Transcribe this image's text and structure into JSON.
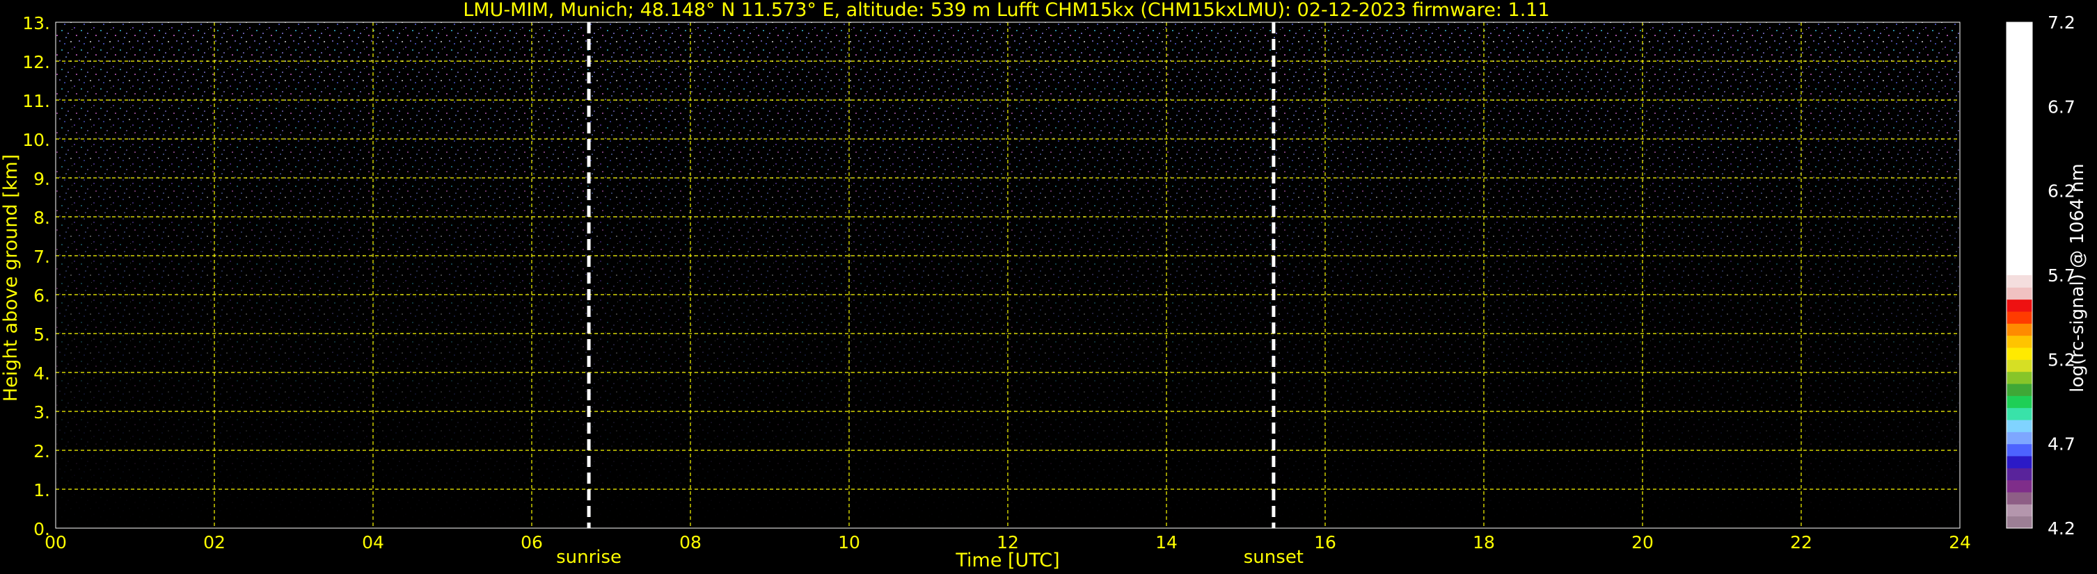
{
  "chart_data": {
    "type": "heatmap",
    "title": "LMU-MIM, Munich; 48.148° N 11.573° E, altitude: 539 m    Lufft CHM15kx (CHM15kxLMU): 02-12-2023    firmware: 1.11",
    "xlabel": "Time [UTC]",
    "ylabel": "Height above ground [km]",
    "x_ticks": [
      "00",
      "02",
      "04",
      "06",
      "08",
      "10",
      "12",
      "14",
      "16",
      "18",
      "20",
      "22",
      "24"
    ],
    "y_ticks": [
      "0.",
      "1.",
      "2.",
      "3.",
      "4.",
      "5.",
      "6.",
      "7.",
      "8.",
      "9.",
      "10.",
      "11.",
      "12.",
      "13."
    ],
    "xlim": [
      0,
      24
    ],
    "ylim": [
      0,
      13
    ],
    "grid": true,
    "annotations": [
      {
        "label": "sunrise",
        "time": 6.72
      },
      {
        "label": "sunset",
        "time": 15.35
      }
    ],
    "colorbar": {
      "label": "log(rc-signal) @ 1064 nm",
      "range": [
        4.2,
        7.2
      ],
      "ticks": [
        "4.2",
        "4.7",
        "5.2",
        "5.7",
        "6.2",
        "6.7",
        "7.2"
      ]
    },
    "colors": {
      "background": "#000000",
      "text": "#ffff00",
      "grid": "#ffff00",
      "marker": "#ffffff",
      "noise": "#9b8cff"
    }
  }
}
